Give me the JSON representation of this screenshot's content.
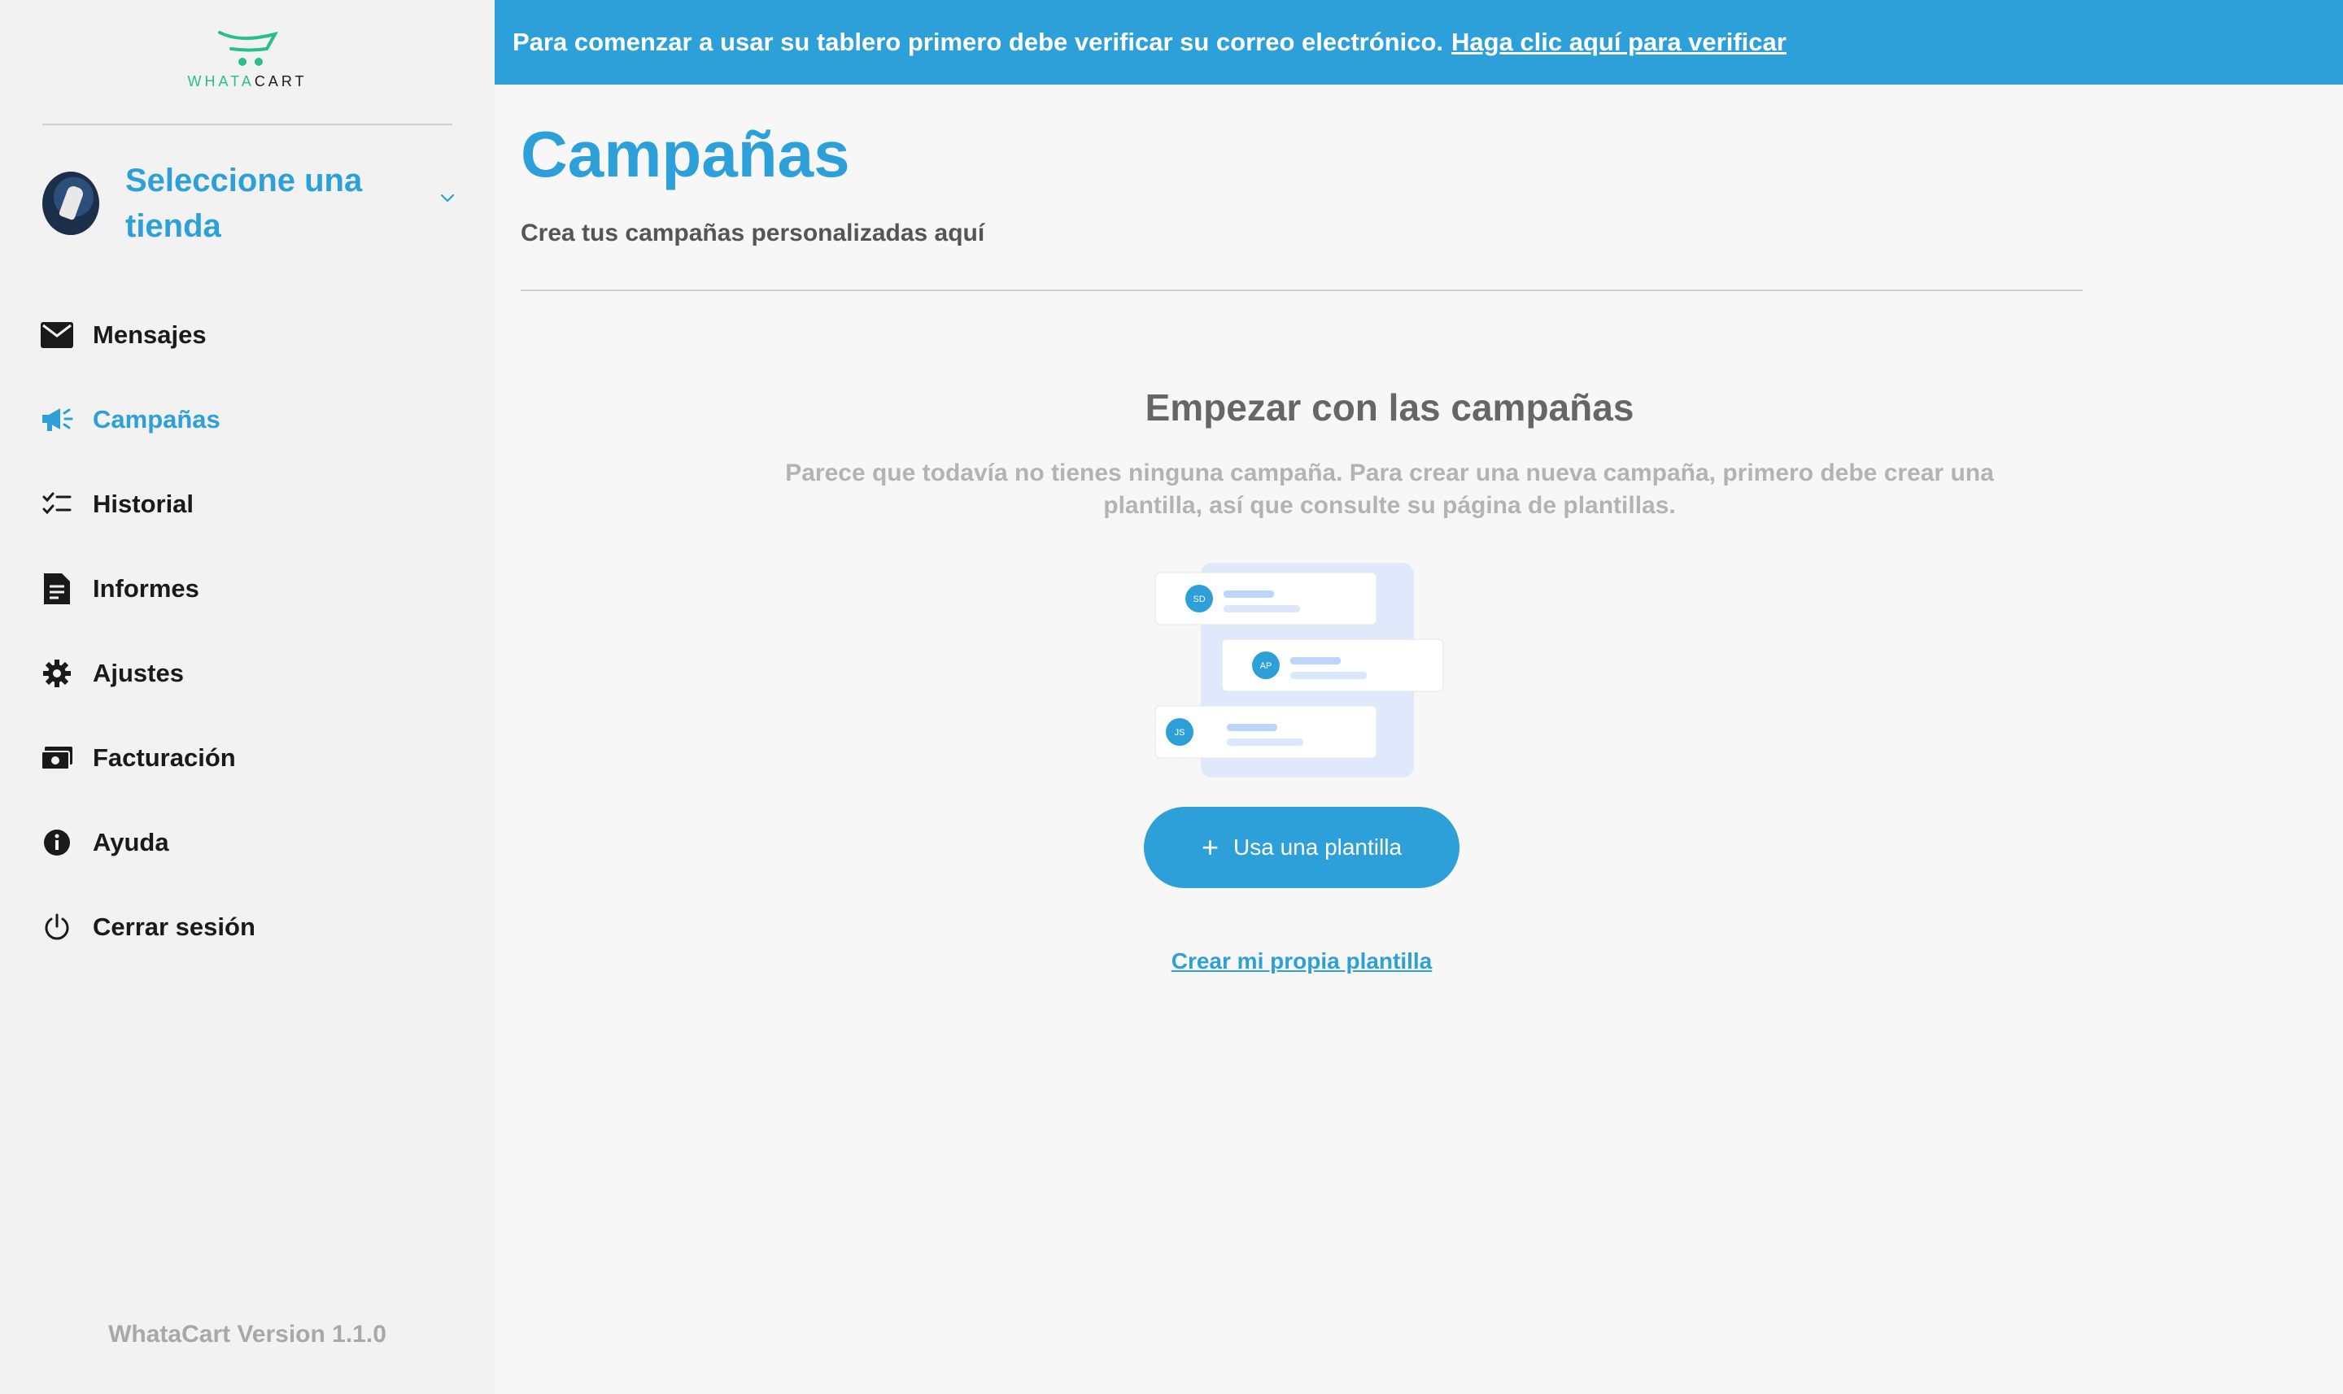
{
  "brand": {
    "logo_text_accent": "WHATA",
    "logo_text_rest": "CART",
    "accent_color": "#2d9fd9",
    "logo_color": "#27c08a"
  },
  "sidebar": {
    "store_select_label": "Seleccione una tienda",
    "items": [
      {
        "label": "Mensajes",
        "icon": "envelope-icon",
        "active": false
      },
      {
        "label": "Campañas",
        "icon": "megaphone-icon",
        "active": true
      },
      {
        "label": "Historial",
        "icon": "checklist-icon",
        "active": false
      },
      {
        "label": "Informes",
        "icon": "report-icon",
        "active": false
      },
      {
        "label": "Ajustes",
        "icon": "gear-icon",
        "active": false
      },
      {
        "label": "Facturación",
        "icon": "money-icon",
        "active": false
      },
      {
        "label": "Ayuda",
        "icon": "info-icon",
        "active": false
      },
      {
        "label": "Cerrar sesión",
        "icon": "power-icon",
        "active": false
      }
    ],
    "version": "WhataCart Version 1.1.0"
  },
  "banner": {
    "message": "Para comenzar a usar su tablero primero debe verificar su correo electrónico.",
    "link": "Haga clic aquí para verificar"
  },
  "main": {
    "title": "Campañas",
    "subtitle": "Crea tus campañas personalizadas aquí",
    "empty_title": "Empezar con las campañas",
    "empty_text": "Parece que todavía no tienes ninguna campaña. Para crear una nueva campaña, primero debe crear una plantilla, así que consulte su página de plantillas.",
    "illustration_initials": [
      "SD",
      "AP",
      "JS"
    ],
    "primary_button": "Usa una plantilla",
    "secondary_link": "Crear mi propia plantilla"
  }
}
